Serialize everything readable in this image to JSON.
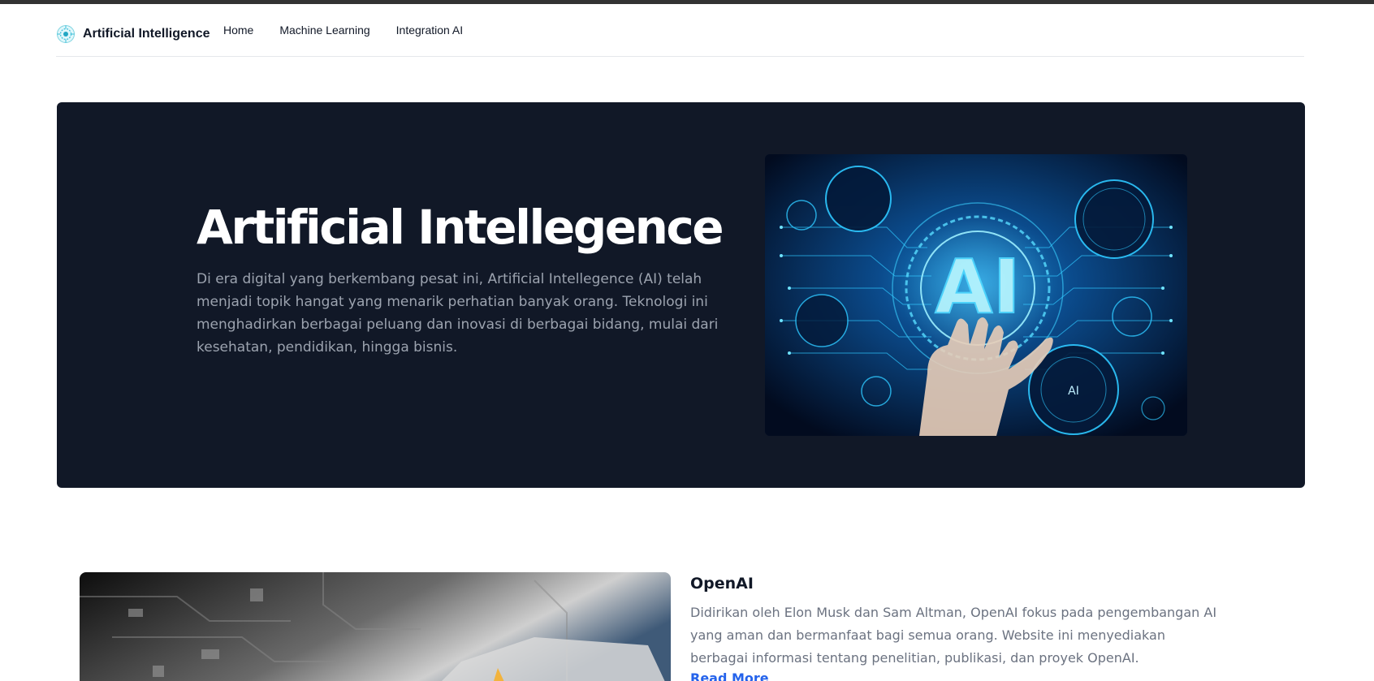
{
  "nav": {
    "brand": "Artificial Intelligence",
    "links": [
      "Home",
      "Machine Learning",
      "Integration AI"
    ]
  },
  "hero": {
    "title": "Artificial Intellegence",
    "description": "Di era digital yang berkembang pesat ini, Artificial Intellegence (AI) telah menjadi topik hangat yang menarik perhatian banyak orang. Teknologi ini menghadirkan berbagai peluang dan inovasi di berbagai bidang, mulai dari kesehatan, pendidikan, hingga bisnis.",
    "image_text": "AI",
    "image_badge": "AI"
  },
  "card": {
    "title": "OpenAI",
    "description": "Didirikan oleh Elon Musk dan Sam Altman, OpenAI fokus pada pengembangan AI yang aman dan bermanfaat bagi semua orang. Website ini menyediakan berbagai informasi tentang penelitian, publikasi, dan proyek OpenAI.",
    "link": "Read More"
  },
  "colors": {
    "hero_bg": "#111827",
    "link": "#2563eb",
    "muted_text": "#9ca3af",
    "topbar": "#333333"
  }
}
